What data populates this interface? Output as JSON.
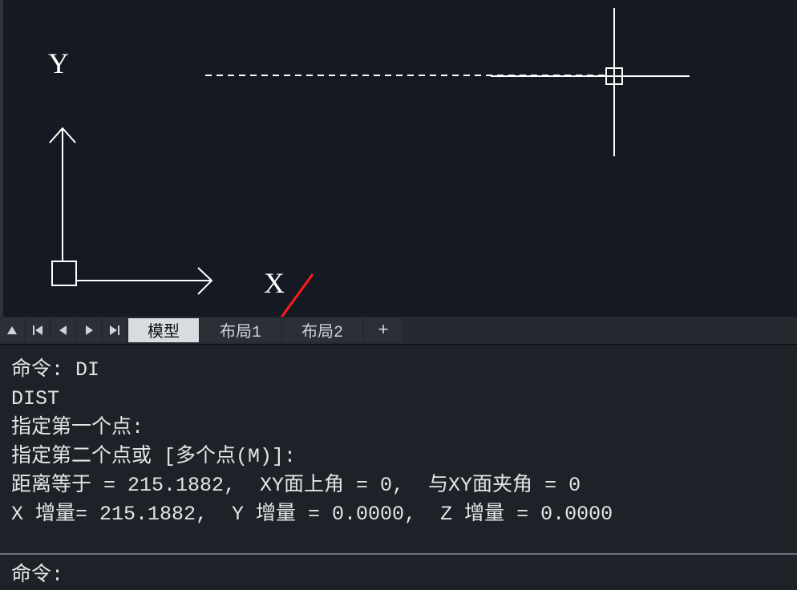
{
  "ucs": {
    "x_label": "X",
    "y_label": "Y"
  },
  "tabs": {
    "model": "模型",
    "layout1": "布局1",
    "layout2": "布局2",
    "add": "+"
  },
  "command_history": {
    "line1": "命令: DI",
    "line2": "DIST",
    "line3": "指定第一个点:",
    "line4": "指定第二个点或 [多个点(M)]:",
    "line5": "距离等于 = 215.1882,  XY面上角 = 0,  与XY面夹角 = 0",
    "line6": "X 增量= 215.1882,  Y 增量 = 0.0000,  Z 增量 = 0.0000"
  },
  "command_input": {
    "prompt": "命令:",
    "value": ""
  },
  "dist_result": {
    "distance": 215.1882,
    "angle_in_xy": 0,
    "angle_from_xy": 0,
    "delta_x": 215.1882,
    "delta_y": 0.0,
    "delta_z": 0.0
  }
}
